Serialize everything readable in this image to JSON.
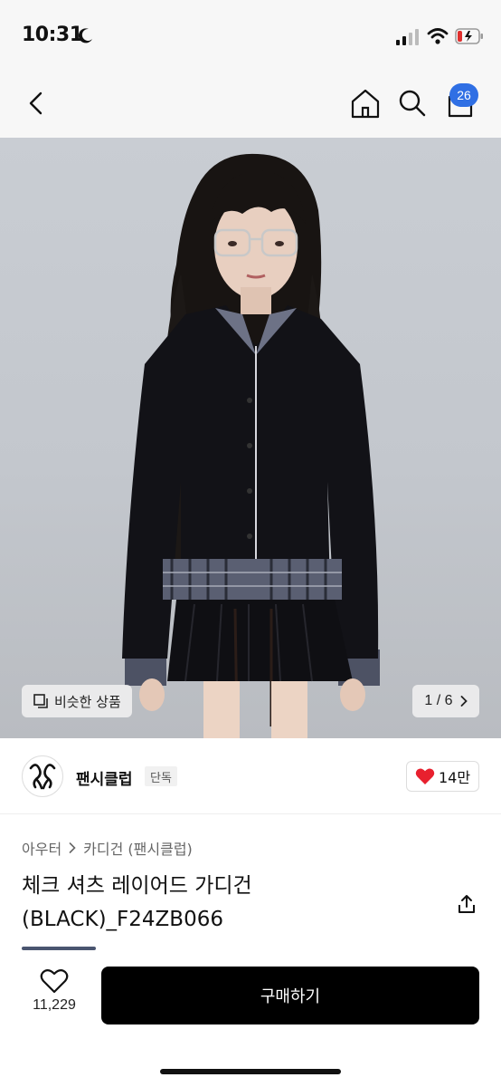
{
  "status_bar": {
    "time": "10:31",
    "icons": [
      "moon-icon",
      "signal-icon",
      "wifi-icon",
      "battery-icon"
    ]
  },
  "nav": {
    "icons": [
      "back-icon",
      "home-icon",
      "search-icon",
      "cart-icon"
    ],
    "cart_badge": "26",
    "badge_color": "#2f6fe4"
  },
  "hero": {
    "similar_label": "비슷한 상품",
    "page_current": "1",
    "page_total": "6",
    "page_counter": "1 / 6"
  },
  "brand": {
    "logo_text": "F",
    "name": "팬시클럽",
    "tag": "단독",
    "likes": "14만",
    "heart_color": "#e8202e"
  },
  "product": {
    "breadcrumb": [
      "아우터",
      "카디건 (팬시클럽)"
    ],
    "title": "체크 셔츠 레이어드 가디건 (BLACK)_F24ZB066"
  },
  "bottom": {
    "wish_count": "11,229",
    "buy_label": "구매하기"
  }
}
